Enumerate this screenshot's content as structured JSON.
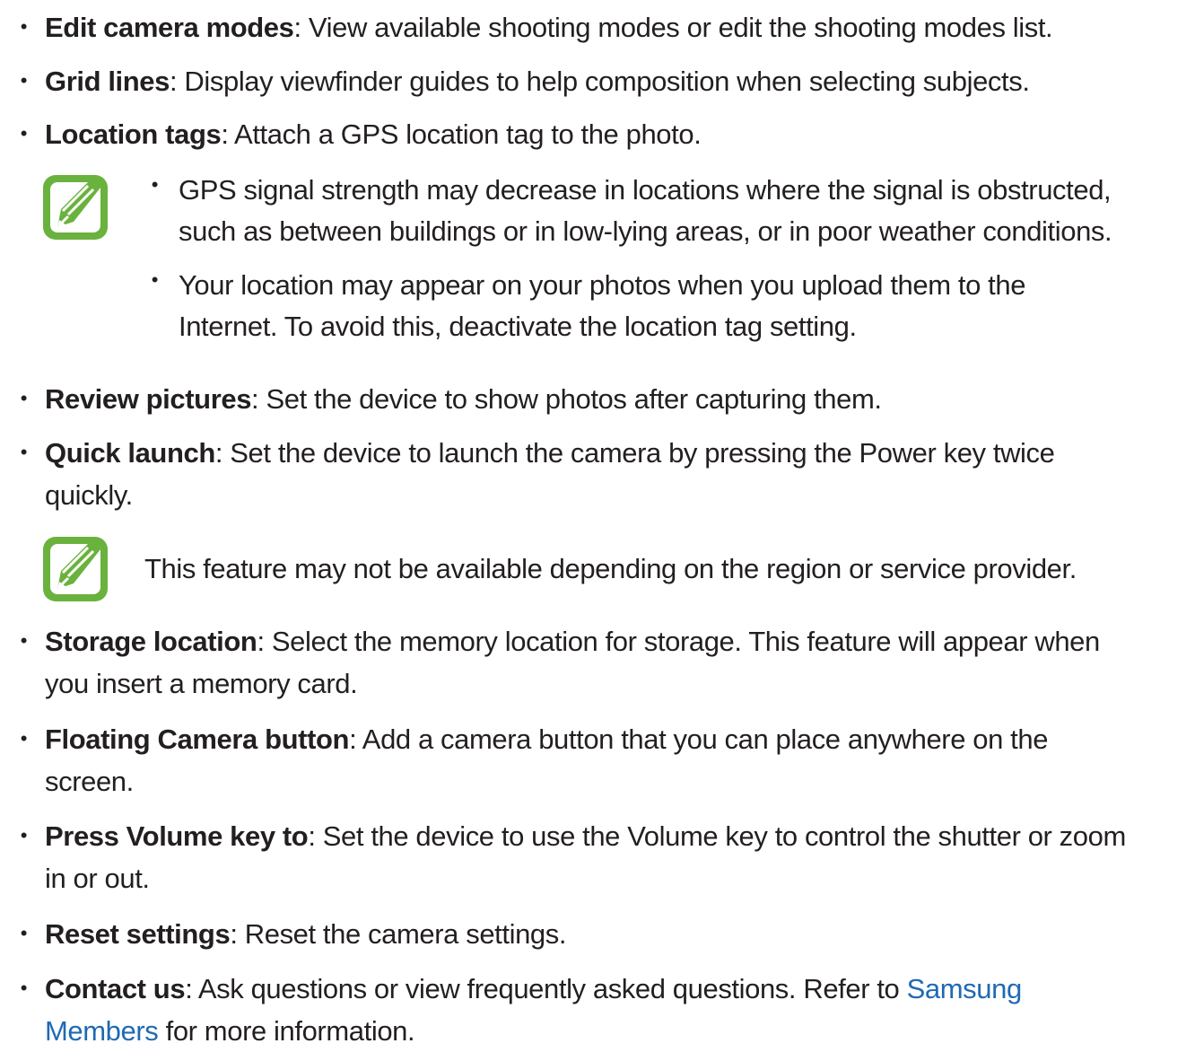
{
  "items": [
    {
      "bullet": "•",
      "term": "Edit camera modes",
      "rest": ": View available shooting modes or edit the shooting modes list."
    },
    {
      "bullet": "•",
      "term": "Grid lines",
      "rest": ": Display viewfinder guides to help composition when selecting subjects."
    },
    {
      "bullet": "•",
      "term": "Location tags",
      "rest": ": Attach a GPS location tag to the photo."
    },
    {
      "bullet": "•",
      "term": "Review pictures",
      "rest": ": Set the device to show photos after capturing them."
    },
    {
      "bullet": "•",
      "term": "Quick launch",
      "rest": ": Set the device to launch the camera by pressing the Power key twice",
      "line2": "quickly."
    },
    {
      "bullet": "•",
      "term": "Storage location",
      "rest": ": Select the memory location for storage. This feature will appear when",
      "line2": "you insert a memory card."
    },
    {
      "bullet": "•",
      "term": "Floating Camera button",
      "rest": ": Add a camera button that you can place anywhere on the",
      "line2": "screen."
    },
    {
      "bullet": "•",
      "term": "Press Volume key to",
      "rest": ": Set the device to use the Volume key to control the shutter or zoom",
      "line2": "in or out."
    },
    {
      "bullet": "•",
      "term": "Reset settings",
      "rest": ": Reset the camera settings."
    },
    {
      "bullet": "•",
      "term": "Contact us",
      "rest": ": Ask questions or view frequently asked questions. Refer to ",
      "link1": "Samsung",
      "link2": "Members",
      "line2_rest": " for more information."
    }
  ],
  "note1": {
    "bullets": [
      {
        "bullet": "•",
        "line1": "GPS signal strength may decrease in locations where the signal is obstructed,",
        "line2": "such as between buildings or in low-lying areas, or in poor weather conditions."
      },
      {
        "bullet": "•",
        "line1": "Your location may appear on your photos when you upload them to the",
        "line2": "Internet. To avoid this, deactivate the location tag setting."
      }
    ]
  },
  "note2": {
    "text": "This feature may not be available depending on the region or service provider."
  },
  "colors": {
    "text": "#231f20",
    "link": "#1e6ab4",
    "note_icon": "#6ab23e"
  }
}
